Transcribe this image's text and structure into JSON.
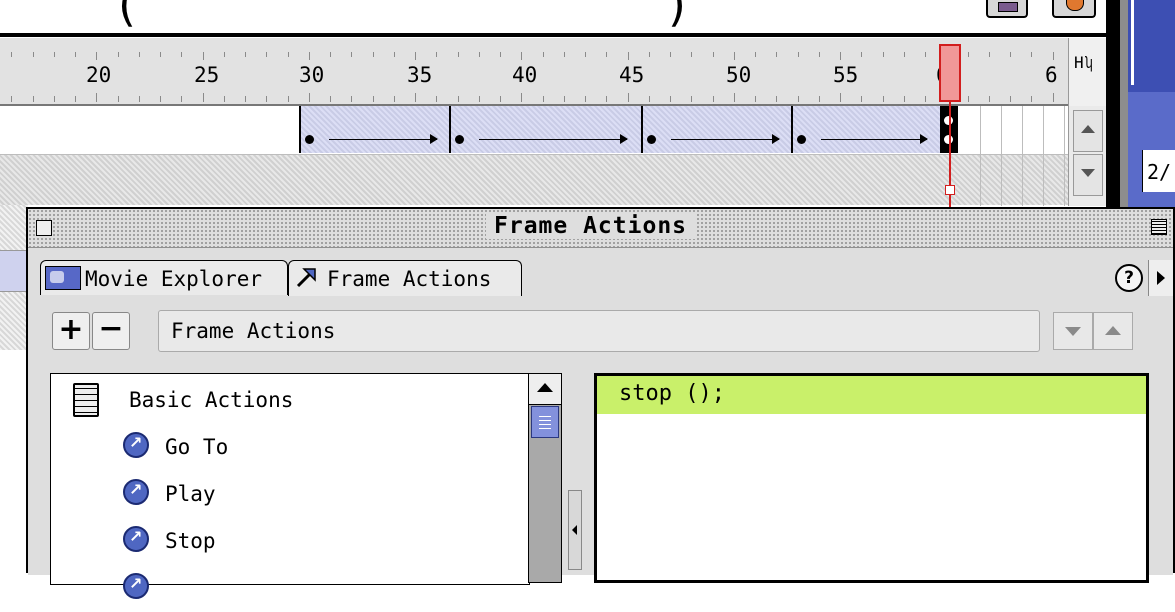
{
  "timeline": {
    "frame_numbers": [
      "20",
      "25",
      "30",
      "35",
      "40",
      "45",
      "50",
      "55",
      "60",
      "6"
    ],
    "current_frame_number": 60,
    "right_panel_partial_text": "2/"
  },
  "panel": {
    "title": "Frame Actions",
    "tabs": [
      {
        "label": "Movie Explorer",
        "icon": "movie-explorer-icon"
      },
      {
        "label": "Frame Actions",
        "icon": "frame-actions-icon",
        "active": true
      }
    ],
    "help_label": "?",
    "toolbar": {
      "plus_label": "+",
      "minus_label": "−",
      "action_field_value": "Frame Actions"
    },
    "toolbox": {
      "category": "Basic Actions",
      "items": [
        "Go To",
        "Play",
        "Stop"
      ]
    },
    "script": {
      "lines": [
        "stop ();"
      ]
    }
  },
  "colors": {
    "highlight_line": "#c9f06a",
    "playhead": "#d21e1e",
    "tween": "#d3d5ef",
    "action_icon": "#4f67c2"
  }
}
